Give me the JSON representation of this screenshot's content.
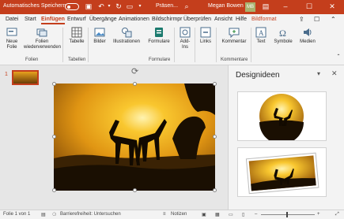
{
  "titlebar": {
    "autosave_label": "Automatisches Speichern",
    "filename": "Präsen...",
    "user_name": "Megan Bowen",
    "user_initials": "MB"
  },
  "menu": {
    "items": [
      "Datei",
      "Start",
      "Einfügen",
      "Entwurf",
      "Übergänge",
      "Animationen",
      "Bildschirmpr",
      "Überprüfen",
      "Ansicht",
      "Hilfe",
      "Bildformat"
    ],
    "active": "Einfügen"
  },
  "ribbon": {
    "buttons": {
      "new_slide": "Neue Folie",
      "reuse_slides": "Folien wiederverwenden",
      "table": "Tabelle",
      "pictures": "Bilder",
      "illustrations": "Illustrationen",
      "formulas": "Formulare",
      "addins": "Add-Ins",
      "links": "Links",
      "comment": "Kommentar",
      "text": "Text",
      "symbols": "Symbole",
      "media": "Medien"
    },
    "groups": {
      "slides": "Folien",
      "tables": "Tabellen",
      "forms": "Formulare",
      "comments": "Kommentare"
    }
  },
  "slides_pane": {
    "slide_number": "1"
  },
  "design_pane": {
    "title": "Designideen"
  },
  "statusbar": {
    "slide_info": "Folie 1 von 1",
    "accessibility": "Barrierefreiheit: Untersuchen",
    "notes": "Notizen"
  }
}
